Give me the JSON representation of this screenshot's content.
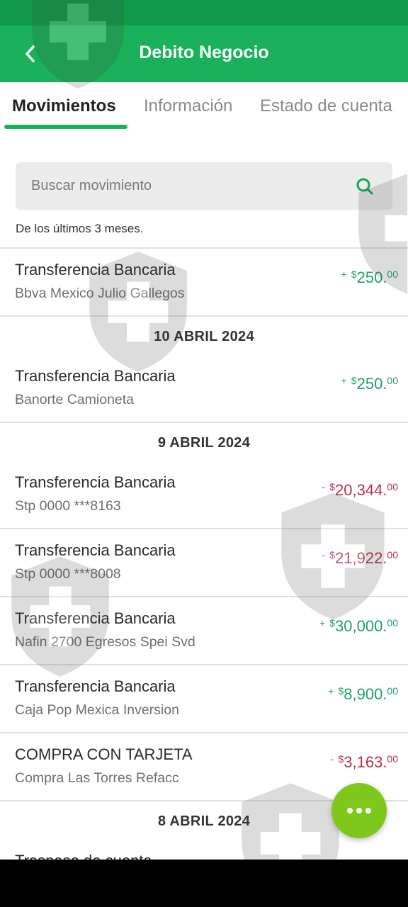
{
  "header": {
    "title": "Debito Negocio",
    "back_icon": "chevron-left-icon"
  },
  "tabs": [
    {
      "label": "Movimientos",
      "active": true
    },
    {
      "label": "Información",
      "active": false
    },
    {
      "label": "Estado de cuenta",
      "active": false
    }
  ],
  "search": {
    "placeholder": "Buscar movimiento",
    "icon": "search-icon"
  },
  "range_note": "De los últimos 3 meses.",
  "movements": [
    {
      "title": "Transferencia Bancaria",
      "subtitle": "Bbva Mexico Julio Gallegos",
      "sign": "+",
      "currency": "$",
      "amount": "250.",
      "cents": "00"
    },
    {
      "date_header": "10 ABRIL 2024"
    },
    {
      "title": "Transferencia Bancaria",
      "subtitle": "Banorte Camioneta",
      "sign": "+",
      "currency": "$",
      "amount": "250.",
      "cents": "00"
    },
    {
      "date_header": "9 ABRIL 2024"
    },
    {
      "title": "Transferencia Bancaria",
      "subtitle": "Stp 0000 ***8163",
      "sign": "-",
      "currency": "$",
      "amount": "20,344.",
      "cents": "00"
    },
    {
      "title": "Transferencia Bancaria",
      "subtitle": "Stp 0000 ***8008",
      "sign": "-",
      "currency": "$",
      "amount": "21,922.",
      "cents": "00"
    },
    {
      "title": "Transferencia Bancaria",
      "subtitle": "Nafin 2700 Egresos Spei Svd",
      "sign": "+",
      "currency": "$",
      "amount": "30,000.",
      "cents": "00"
    },
    {
      "title": "Transferencia Bancaria",
      "subtitle": "Caja Pop Mexica Inversion",
      "sign": "+",
      "currency": "$",
      "amount": "8,900.",
      "cents": "00"
    },
    {
      "title": "COMPRA CON TARJETA",
      "subtitle": "Compra Las Torres Refacc",
      "sign": "-",
      "currency": "$",
      "amount": "3,163.",
      "cents": "00"
    },
    {
      "date_header": "8 ABRIL 2024"
    },
    {
      "title": "Traspaso de cuenta",
      "subtitle": "",
      "sign": "",
      "currency": "",
      "amount": "",
      "cents": ""
    }
  ],
  "fab": {
    "icon": "more-horizontal-icon"
  },
  "colors": {
    "status_bar": "#0f9948",
    "header": "#19b15a",
    "positive": "#20a065",
    "negative": "#b5324a",
    "fab": "#7ec81c"
  }
}
